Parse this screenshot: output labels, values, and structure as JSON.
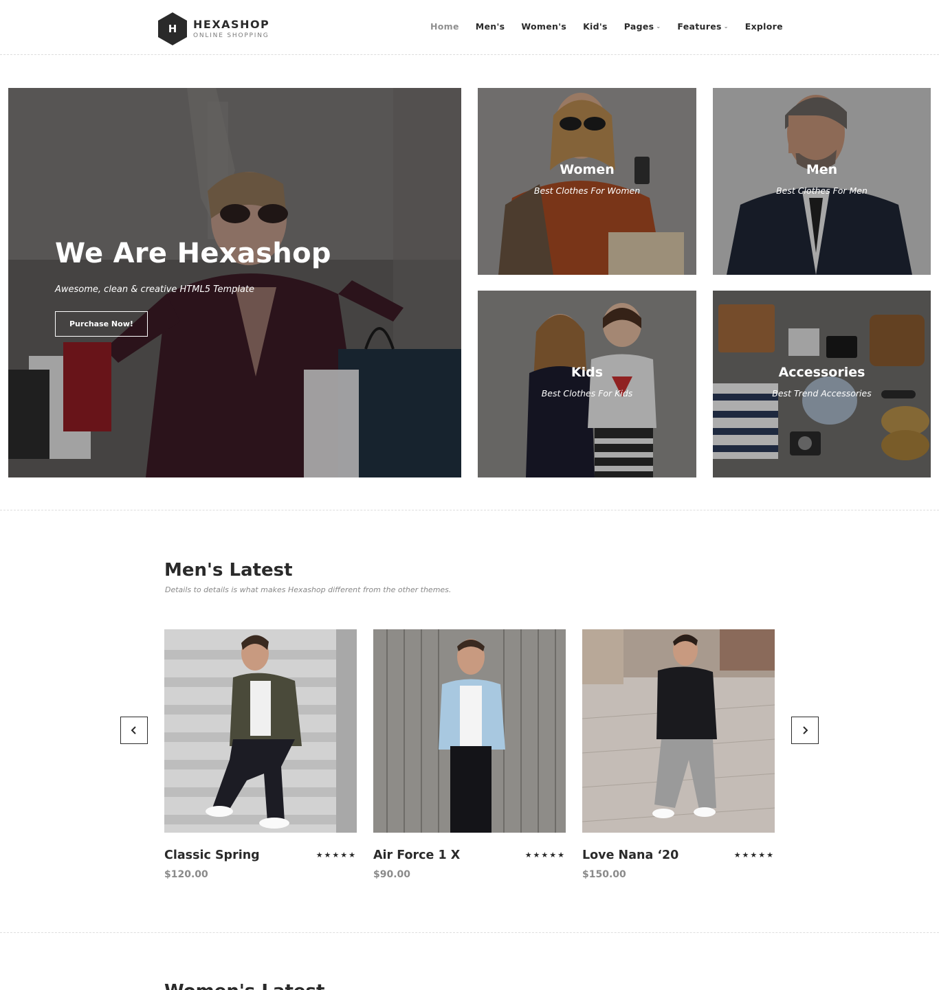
{
  "brand": {
    "logo_letter": "H",
    "name": "HEXASHOP",
    "tagline": "ONLINE SHOPPING"
  },
  "nav": [
    {
      "label": "Home",
      "active": true,
      "dropdown": false
    },
    {
      "label": "Men's",
      "active": false,
      "dropdown": false
    },
    {
      "label": "Women's",
      "active": false,
      "dropdown": false
    },
    {
      "label": "Kid's",
      "active": false,
      "dropdown": false
    },
    {
      "label": "Pages",
      "active": false,
      "dropdown": true
    },
    {
      "label": "Features",
      "active": false,
      "dropdown": true
    },
    {
      "label": "Explore",
      "active": false,
      "dropdown": false
    }
  ],
  "hero": {
    "title": "We Are Hexashop",
    "subtitle": "Awesome, clean & creative HTML5 Template",
    "button": "Purchase Now!"
  },
  "categories": [
    {
      "title": "Women",
      "subtitle": "Best Clothes For Women"
    },
    {
      "title": "Men",
      "subtitle": "Best Clothes For Men"
    },
    {
      "title": "Kids",
      "subtitle": "Best Clothes For Kids"
    },
    {
      "title": "Accessories",
      "subtitle": "Best Trend Accessories"
    }
  ],
  "mens_latest": {
    "title": "Men's Latest",
    "subtitle": "Details to details is what makes Hexashop different from the other themes.",
    "prev_icon": "chevron-left-icon",
    "next_icon": "chevron-right-icon",
    "products": [
      {
        "name": "Classic Spring",
        "price": "$120.00",
        "rating": 5,
        "stars": "★★★★★"
      },
      {
        "name": "Air Force 1 X",
        "price": "$90.00",
        "rating": 5,
        "stars": "★★★★★"
      },
      {
        "name": "Love Nana ‘20",
        "price": "$150.00",
        "rating": 5,
        "stars": "★★★★★"
      }
    ]
  },
  "womens_latest": {
    "title": "Women's Latest"
  },
  "colors": {
    "text": "#2a2a2a",
    "muted": "#8a8a8a",
    "background": "#ffffff"
  }
}
